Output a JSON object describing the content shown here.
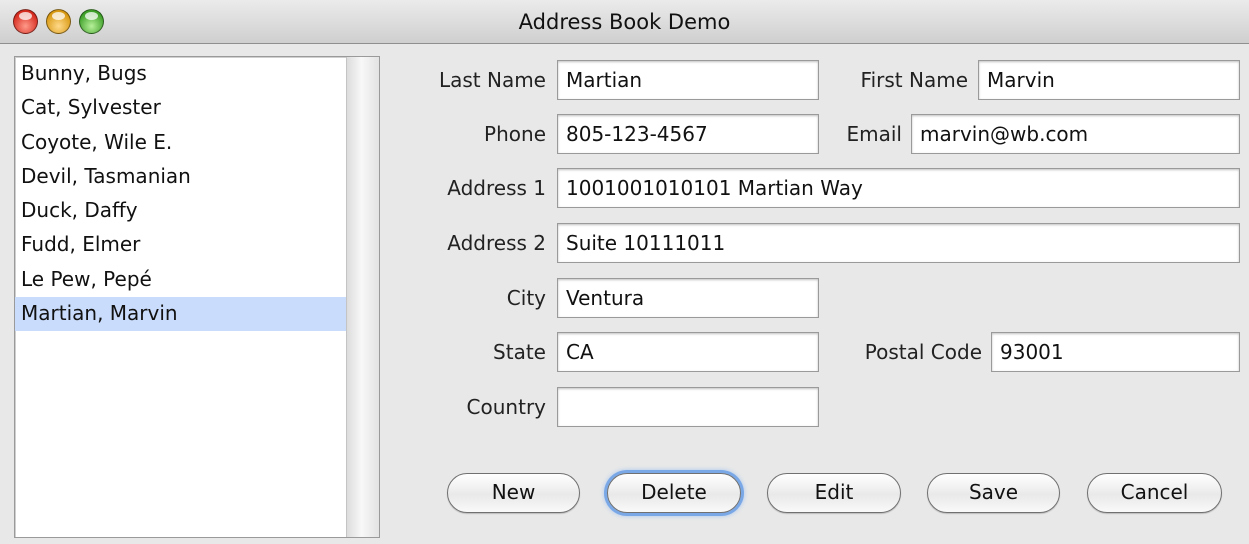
{
  "window": {
    "title": "Address Book Demo"
  },
  "contacts": [
    {
      "label": "Bunny, Bugs",
      "selected": false
    },
    {
      "label": "Cat, Sylvester",
      "selected": false
    },
    {
      "label": "Coyote, Wile E.",
      "selected": false
    },
    {
      "label": "Devil, Tasmanian",
      "selected": false
    },
    {
      "label": "Duck, Daffy",
      "selected": false
    },
    {
      "label": "Fudd, Elmer",
      "selected": false
    },
    {
      "label": "Le Pew, Pepé",
      "selected": false
    },
    {
      "label": "Martian, Marvin",
      "selected": true
    }
  ],
  "form": {
    "last_name": {
      "label": "Last Name",
      "value": "Martian"
    },
    "first_name": {
      "label": "First Name",
      "value": "Marvin"
    },
    "phone": {
      "label": "Phone",
      "value": "805-123-4567"
    },
    "email": {
      "label": "Email",
      "value": "marvin@wb.com"
    },
    "address1": {
      "label": "Address 1",
      "value": "1001001010101 Martian Way"
    },
    "address2": {
      "label": "Address 2",
      "value": "Suite 10111011"
    },
    "city": {
      "label": "City",
      "value": "Ventura"
    },
    "state": {
      "label": "State",
      "value": "CA"
    },
    "postal": {
      "label": "Postal Code",
      "value": "93001"
    },
    "country": {
      "label": "Country",
      "value": ""
    }
  },
  "buttons": {
    "new": "New",
    "delete": "Delete",
    "edit": "Edit",
    "save": "Save",
    "cancel": "Cancel"
  },
  "colors": {
    "selection": "#c9dcfb",
    "focus_ring": "#7aa8e6"
  }
}
